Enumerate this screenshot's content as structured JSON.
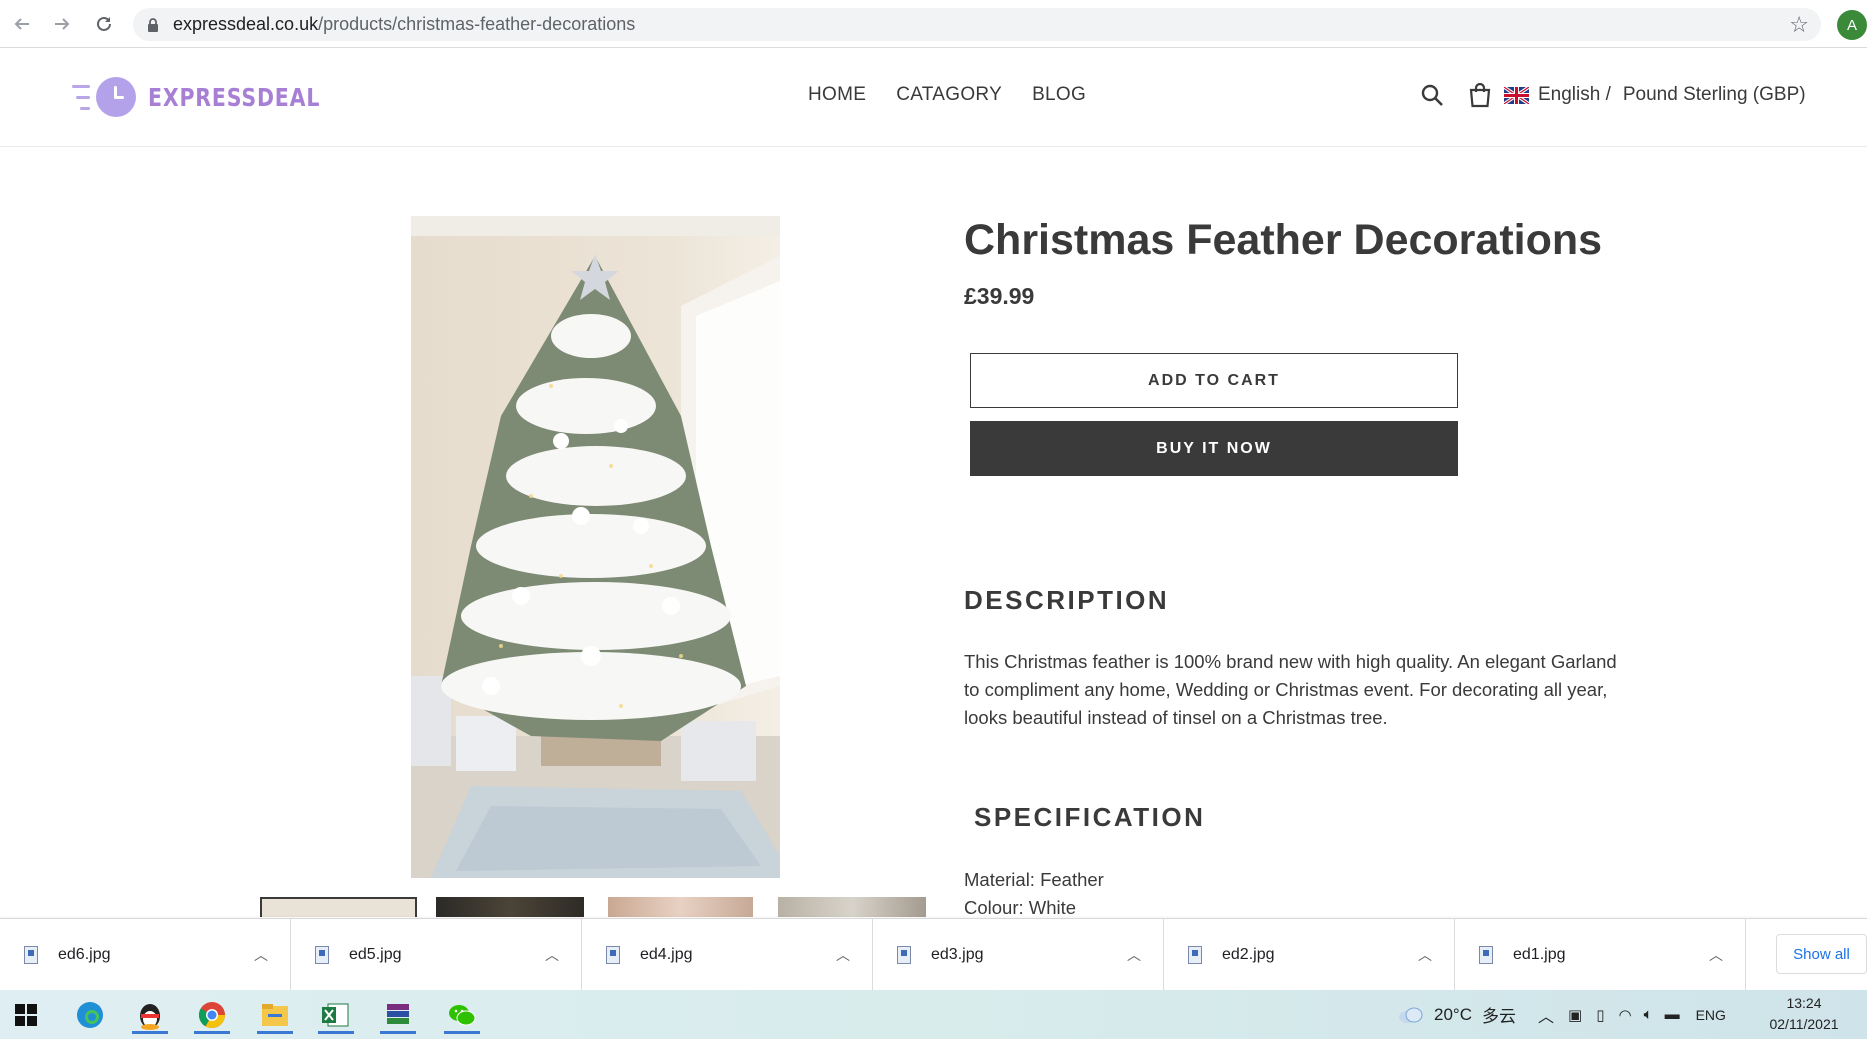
{
  "browser": {
    "url_domain": "expressdeal.co.uk",
    "url_path": "/products/christmas-feather-decorations",
    "profile_initial": "A",
    "icons": [
      "back-arrow-icon",
      "forward-arrow-icon",
      "reload-icon",
      "lock-icon",
      "bookmark-star-icon"
    ]
  },
  "header": {
    "logo_text": "EXPRESSDEAL",
    "nav": [
      "HOME",
      "CATAGORY",
      "BLOG"
    ],
    "language": "English /",
    "currency": "Pound Sterling (GBP)"
  },
  "product": {
    "title": "Christmas Feather Decorations",
    "price": "£39.99",
    "add_to_cart": "ADD TO CART",
    "buy_now": "BUY IT NOW",
    "description_heading": "DESCRIPTION",
    "description": "This Christmas feather is 100% brand new with high quality. An elegant Garland to compliment any home, Wedding or Christmas event. For decorating all year, looks beautiful instead of tinsel on a Christmas tree.",
    "specification_heading": "SPECIFICATION",
    "spec_material": "Material: Feather",
    "spec_colour": "Colour: White"
  },
  "downloads": {
    "files": [
      "ed6.jpg",
      "ed5.jpg",
      "ed4.jpg",
      "ed3.jpg",
      "ed2.jpg",
      "ed1.jpg"
    ],
    "show_all": "Show all"
  },
  "taskbar": {
    "weather_temp": "20°C",
    "weather_desc": "多云",
    "input_lang": "ENG",
    "time": "13:24",
    "date": "02/11/2021"
  },
  "colors": {
    "brand_purple": "#a780d6",
    "button_dark": "#3a3a3a",
    "link_blue": "#1a73e8"
  }
}
